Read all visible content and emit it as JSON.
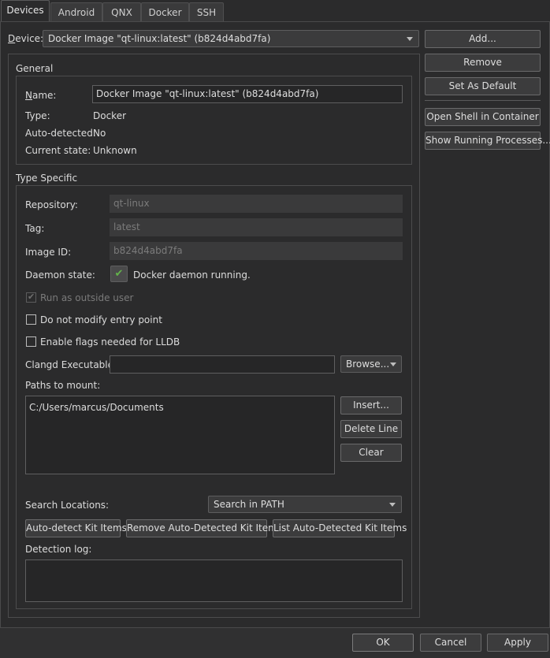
{
  "tabs": [
    "Devices",
    "Android",
    "QNX",
    "Docker",
    "SSH"
  ],
  "device": {
    "label": "Device:",
    "label_underline": "D",
    "label_rest": "evice:",
    "selected": "Docker Image \"qt-linux:latest\" (b824d4abd7fa)"
  },
  "side_buttons": {
    "add": "Add...",
    "remove": "Remove",
    "set_default": "Set As Default",
    "open_shell": "Open Shell in Container",
    "show_processes": "Show Running Processes..."
  },
  "general": {
    "title": "General",
    "name_label": "Name:",
    "name_value": "Docker Image \"qt-linux:latest\" (b824d4abd7fa)",
    "type_label": "Type:",
    "type_value": "Docker",
    "auto_label": "Auto-detected:",
    "auto_value": "No",
    "state_label": "Current state:",
    "state_value": "Unknown"
  },
  "type_specific": {
    "title": "Type Specific",
    "repository_label": "Repository:",
    "repository_value": "qt-linux",
    "tag_label": "Tag:",
    "tag_value": "latest",
    "image_id_label": "Image ID:",
    "image_id_value": "b824d4abd7fa",
    "daemon_label": "Daemon state:",
    "daemon_value": "Docker daemon running.",
    "run_outside_user": "Run as outside user",
    "no_modify_entry": "Do not modify entry point",
    "lldb_flags": "Enable flags needed for LLDB",
    "clangd_label": "Clangd Executable:",
    "clangd_value": "",
    "browse": "Browse...",
    "paths_label": "Paths to mount:",
    "paths": [
      "C:/Users/marcus/Documents"
    ],
    "insert": "Insert...",
    "delete_line": "Delete Line",
    "clear": "Clear",
    "search_label": "Search Locations:",
    "search_value": "Search in PATH",
    "auto_detect_kit": "Auto-detect Kit Items",
    "remove_auto_kit": "Remove Auto-Detected Kit Items",
    "list_auto_kit": "List Auto-Detected Kit Items",
    "detection_log_label": "Detection log:"
  },
  "footer": {
    "ok": "OK",
    "cancel": "Cancel",
    "apply": "Apply"
  },
  "colors": {
    "background": "#2b2b2c",
    "check_green": "#63b34b"
  },
  "state": {
    "run_outside_user_checked": true,
    "run_outside_user_enabled": false,
    "no_modify_entry_checked": false,
    "lldb_flags_checked": false,
    "daemon_running": true
  }
}
